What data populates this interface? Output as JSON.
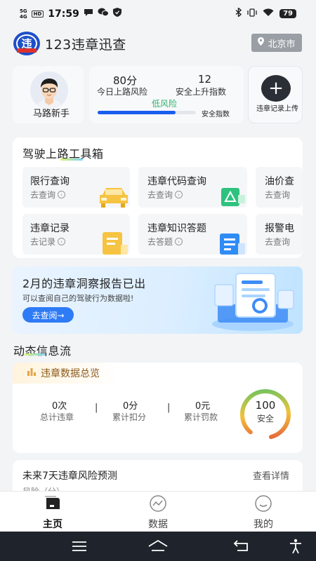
{
  "status_bar": {
    "time": "17:59",
    "net_top": "5G",
    "net_bottom": "4G",
    "hd": "HD",
    "battery": "79"
  },
  "header": {
    "app_name": "123违章迅查",
    "logo_text": "违",
    "city": "北京市"
  },
  "user": {
    "name": "马路新手"
  },
  "stats": {
    "score_value": "80分",
    "score_label": "今日上路风险",
    "index_value": "12",
    "index_label": "安全上升指数",
    "risk_level": "低风险",
    "safety_label": "安全指数",
    "safety_progress": 0.79
  },
  "upload": {
    "label": "违章记录上传"
  },
  "toolbox": {
    "title": "驾驶上路工具箱",
    "tiles": [
      {
        "title": "限行查询",
        "sub": "去查询"
      },
      {
        "title": "违章代码查询",
        "sub": "去查询"
      },
      {
        "title": "油价查",
        "sub": "去查询"
      },
      {
        "title": "违章记录",
        "sub": "去记录"
      },
      {
        "title": "违章知识答题",
        "sub": "去答题"
      },
      {
        "title": "报警电",
        "sub": "去查询"
      }
    ]
  },
  "banner": {
    "title": "2月的违章洞察报告已出",
    "subtitle": "可以查阅自己的驾驶行为数据啦!",
    "button": "去查阅→"
  },
  "feed": {
    "title": "动态信息流",
    "summary_tag": "违章数据总览",
    "summary": [
      {
        "value": "0次",
        "label": "总计违章"
      },
      {
        "value": "0分",
        "label": "累计扣分"
      },
      {
        "value": "0元",
        "label": "累计罚款"
      }
    ],
    "separator": "|",
    "gauge_value": "100",
    "gauge_label": "安全",
    "forecast_title": "未来7天违章风险预测",
    "forecast_link": "查看详情",
    "forecast_peek": "风险（分）"
  },
  "tabs": [
    {
      "label": "主页",
      "active": true
    },
    {
      "label": "数据",
      "active": false
    },
    {
      "label": "我的",
      "active": false
    }
  ],
  "colors": {
    "accent_blue": "#1a5ef0",
    "risk_green": "#2db26c",
    "banner_button": "#2e7bf6",
    "nav_bg": "#1f242c"
  }
}
